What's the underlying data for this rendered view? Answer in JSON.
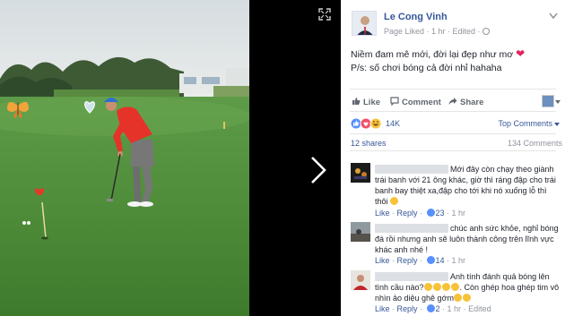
{
  "post": {
    "author": "Le Cong Vinh",
    "meta": "Page Liked · 1 hr · Edited ·",
    "text_line1": "Niềm đam mê mới, đời lại đẹp như mơ",
    "text_line2": "P/s: số chơi bóng cả đời nhỉ hahaha"
  },
  "actions": {
    "like": "Like",
    "comment": "Comment",
    "share": "Share"
  },
  "reactions": {
    "count": "14K",
    "sort": "Top Comments"
  },
  "counts": {
    "shares": "12 shares",
    "comments": "134 Comments"
  },
  "comments": [
    {
      "text": "Mới đây còn chạy theo giành trái banh với 21 ông khác, giờ thì ráng đập cho trái banh bay thiệt xa,đập cho tới khi nó xuống lỗ thì thôi",
      "like": "Like",
      "reply": "Reply",
      "likes": "23",
      "time": "1 hr"
    },
    {
      "text": "chúc anh sức khỏe, nghỉ bóng đá rồi nhưng anh sẽ luôn thành công trên lĩnh vực khác anh nhé !",
      "like": "Like",
      "reply": "Reply",
      "likes": "14",
      "time": "1 hr"
    },
    {
      "text": "Anh tính đánh quả bóng lên tình cầu nào?",
      "text2": ". Còn ghép hoa ghép tim vô nhìn ảo diệu ghê gớm",
      "like": "Like",
      "reply": "Reply",
      "likes": "2",
      "time": "1 hr",
      "edited": "Edited"
    }
  ],
  "colors": {
    "link": "#365899",
    "like_blue": "#5890ff",
    "heart": "#e0245e",
    "muted": "#90949c"
  }
}
